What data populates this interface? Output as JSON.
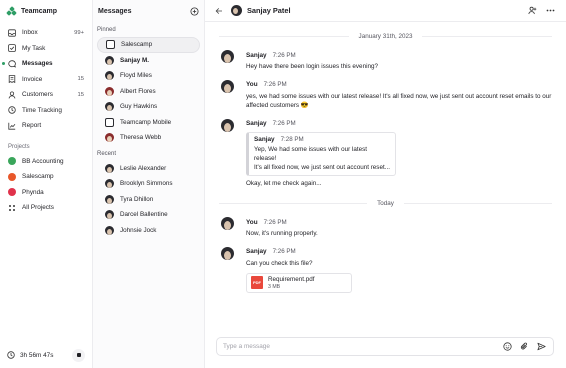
{
  "brand": {
    "name": "Teamcamp"
  },
  "nav": {
    "items": [
      {
        "label": "Inbox",
        "count": "99+",
        "icon": "inbox-icon"
      },
      {
        "label": "My Task",
        "count": "",
        "icon": "task-icon"
      },
      {
        "label": "Messages",
        "count": "",
        "icon": "messages-icon",
        "active": true
      },
      {
        "label": "Invoice",
        "count": "15",
        "icon": "invoice-icon"
      },
      {
        "label": "Customers",
        "count": "15",
        "icon": "customers-icon"
      },
      {
        "label": "Time Tracking",
        "count": "",
        "icon": "clock-icon"
      },
      {
        "label": "Report",
        "count": "",
        "icon": "report-icon"
      }
    ],
    "projects_title": "Projects",
    "projects": [
      {
        "label": "BB Accounting",
        "color": "#3aa65b"
      },
      {
        "label": "Salescamp",
        "color": "#e8572a"
      },
      {
        "label": "Phynda",
        "color": "#e0324b"
      }
    ],
    "all_projects": "All Projects",
    "timer": "3h 56m 47s"
  },
  "messages": {
    "title": "Messages",
    "pinned_title": "Pinned",
    "pinned": [
      {
        "name": "Salescamp",
        "avatar": "team"
      },
      {
        "name": "Sanjay M.",
        "avatar": "dark"
      },
      {
        "name": "Floyd Miles",
        "avatar": "dark"
      },
      {
        "name": "Albert Flores",
        "avatar": "red"
      },
      {
        "name": "Guy Hawkins",
        "avatar": "dark"
      },
      {
        "name": "Teamcamp Mobile",
        "avatar": "team"
      },
      {
        "name": "Theresa Webb",
        "avatar": "red"
      }
    ],
    "recent_title": "Recent",
    "recent": [
      {
        "name": "Leslie Alexander",
        "avatar": "dark"
      },
      {
        "name": "Brooklyn Simmons",
        "avatar": "dark"
      },
      {
        "name": "Tyra Dhillon",
        "avatar": "dark"
      },
      {
        "name": "Darcel Ballentine",
        "avatar": "dark"
      },
      {
        "name": "Johnsie Jock",
        "avatar": "dark"
      }
    ]
  },
  "chat": {
    "title": "Sanjay Patel",
    "day1": "January 31th, 2023",
    "msg1": {
      "who": "Sanjay",
      "time": "7:26 PM",
      "text": "Hey have there been login issues this evening?"
    },
    "msg2": {
      "who": "You",
      "time": "7:26 PM",
      "text": "yes, we had some issues with our latest release! It's all fixed now, we just sent out account reset emails to our affected customers 😎"
    },
    "msg3": {
      "who": "Sanjay",
      "time": "7:26 PM",
      "quote_who": "Sanjay",
      "quote_time": "7:28 PM",
      "quote_line1": "Yep, We had some issues with our latest release!",
      "quote_line2": "It's all fixed now, we just sent out account reset...",
      "text": "Okay, let me check again..."
    },
    "day2": "Today",
    "msg4": {
      "who": "You",
      "time": "7:26 PM",
      "text": "Now, it's running properly."
    },
    "msg5": {
      "who": "Sanjay",
      "time": "7:26 PM",
      "text": "Can you check this file?",
      "file_name": "Requirement.pdf",
      "file_size": "3 MB",
      "file_type": "PDF"
    },
    "composer_placeholder": "Type a message"
  },
  "colors": {
    "accent": "#2f9e66",
    "pdf": "#e9483c"
  }
}
